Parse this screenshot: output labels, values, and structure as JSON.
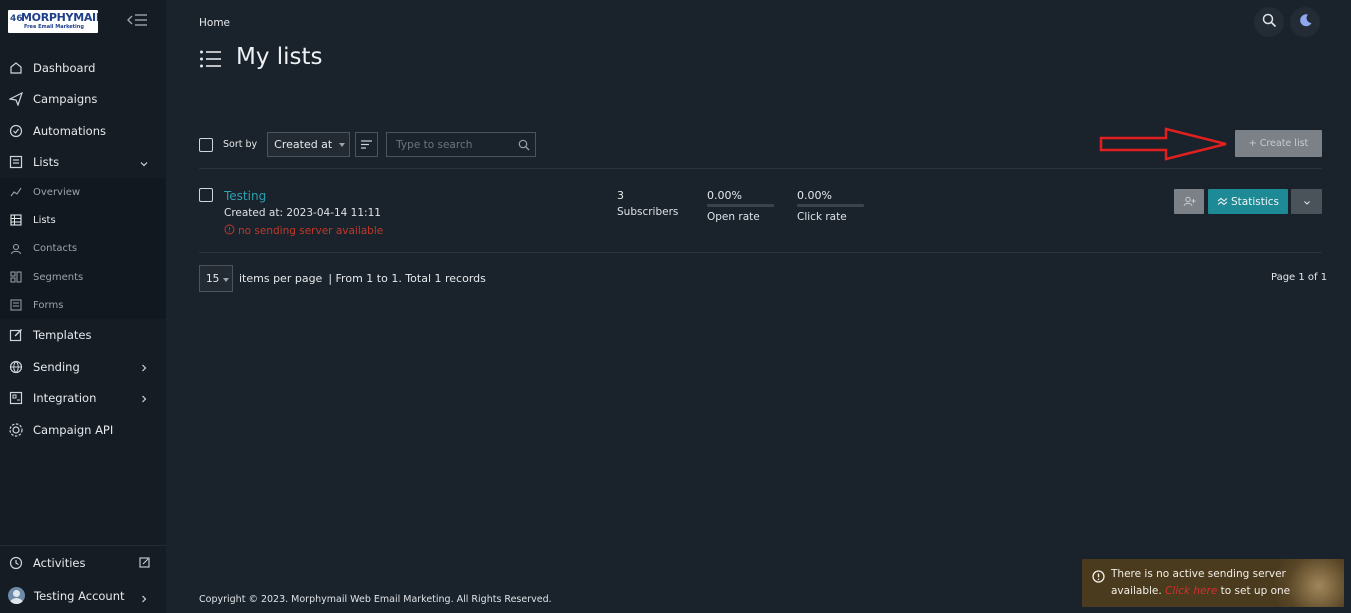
{
  "sidebar": {
    "logo": {
      "mark": "46",
      "title": "MORPHYMAIL",
      "subtitle": "Free Email Marketing"
    },
    "items": [
      {
        "label": "Dashboard",
        "icon": "home-icon"
      },
      {
        "label": "Campaigns",
        "icon": "send-icon"
      },
      {
        "label": "Automations",
        "icon": "clock-icon"
      },
      {
        "label": "Lists",
        "icon": "list-icon",
        "expanded": true
      }
    ],
    "sub_items": [
      {
        "label": "Overview",
        "icon": "chart-icon"
      },
      {
        "label": "Lists",
        "icon": "table-icon",
        "active": true
      },
      {
        "label": "Contacts",
        "icon": "user-icon"
      },
      {
        "label": "Segments",
        "icon": "segments-icon"
      },
      {
        "label": "Forms",
        "icon": "form-icon"
      }
    ],
    "items_after": [
      {
        "label": "Templates",
        "icon": "edit-icon"
      },
      {
        "label": "Sending",
        "icon": "sending-icon"
      },
      {
        "label": "Integration",
        "icon": "integration-icon"
      },
      {
        "label": "Campaign API",
        "icon": "api-icon"
      }
    ],
    "bottom": {
      "activities": "Activities",
      "account": "Testing Account"
    }
  },
  "header": {
    "breadcrumb": "Home",
    "title": "My lists"
  },
  "toolbar": {
    "sort_label": "Sort by",
    "sort_value": "Created at",
    "search_placeholder": "Type to search",
    "create_label": "+ Create list"
  },
  "lists": [
    {
      "name": "Testing",
      "created": "Created at: 2023-04-14 11:11",
      "warning": "no sending server available",
      "subscribers_count": "3",
      "subscribers_label": "Subscribers",
      "open_rate": "0.00%",
      "open_rate_value": 0,
      "open_rate_label": "Open rate",
      "click_rate": "0.00%",
      "click_rate_value": 0,
      "click_rate_label": "Click rate",
      "stats_label": "Statistics"
    }
  ],
  "pagination": {
    "per_page": "15",
    "per_page_label": "items per page",
    "range": "| From 1 to 1. Total 1 records",
    "page_of": "Page 1 of 1"
  },
  "footer": "Copyright © 2023. Morphymail Web Email Marketing. All Rights Reserved.",
  "toast": {
    "text_before": "There is no active sending server available.",
    "link": "Click here",
    "text_after": "to set up one"
  },
  "colors": {
    "background": "#1a222b",
    "sidebar": "#151c23",
    "accent": "#2d9fb0",
    "statistics_button": "#1d8a95",
    "warning": "#c0392b",
    "annotation_arrow": "#e02020"
  }
}
